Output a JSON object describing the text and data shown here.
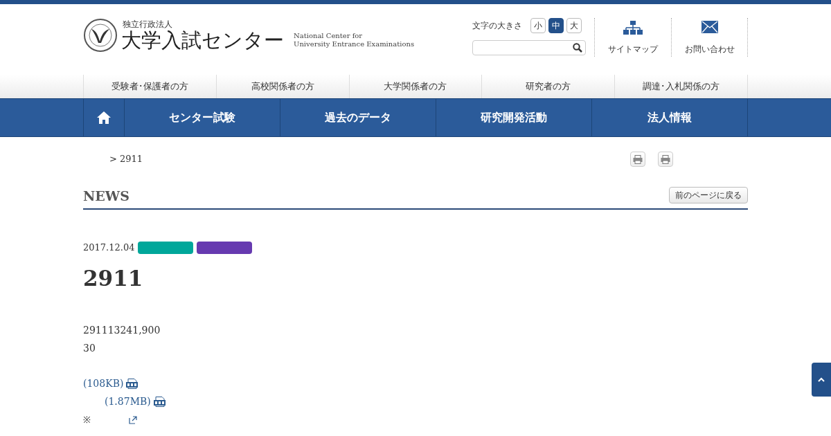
{
  "header": {
    "org_type": "独立行政法人",
    "org_name": "大学入試センター",
    "english_name": [
      "National Center for",
      "University Entrance Examinations"
    ],
    "font_size": {
      "label": "文字の大きさ",
      "options": [
        {
          "label": "小",
          "selected": false
        },
        {
          "label": "中",
          "selected": true
        },
        {
          "label": "大",
          "selected": false
        }
      ]
    },
    "links": [
      {
        "label": "サイトマップ",
        "kind": "sitemap"
      },
      {
        "label": "お問い合わせ",
        "kind": "mail"
      }
    ]
  },
  "audience_nav": [
    "受験者･保護者の方",
    "高校関係者の方",
    "大学関係者の方",
    "研究者の方",
    "調達･入札関係の方"
  ],
  "main_nav": [
    "センター試験",
    "過去のデータ",
    "研究開発活動",
    "法人情報"
  ],
  "breadcrumb": "> 2911",
  "section": {
    "title": "NEWS",
    "back_button": "前のページに戻る"
  },
  "article": {
    "date": "2017.12.04",
    "tags": [
      {
        "color": "#00a79a"
      },
      {
        "color": "#663ab0"
      }
    ],
    "title": "2911",
    "paragraphs": [
      "291113241,900",
      "30"
    ],
    "files": [
      {
        "text": "(108KB)",
        "children": [
          {
            "text": "(1.87MB)"
          }
        ]
      }
    ],
    "note": {
      "mark": "※"
    }
  }
}
